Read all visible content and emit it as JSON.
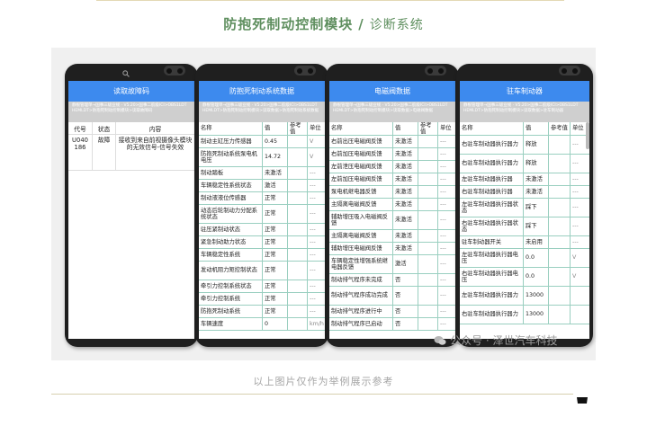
{
  "title": {
    "main": "防抱死制动控制模块",
    "separator": "/",
    "sub": "诊断系统"
  },
  "caption": "以上图片仅作为举例展示参考",
  "watermark": "公众号 · 泽世汽车科技",
  "phones": {
    "dtc": {
      "title": "读取故障码",
      "breadcrumb": "静根管理单→国事三级业规 · V5.20>国事二航级ICI>OBS1LDT HEMLDT>防抱死制动控制模块>读取故障码",
      "headers": {
        "code": "代号",
        "status": "状态",
        "content": "内容"
      },
      "row": {
        "code": "U040186",
        "status": "故障",
        "content": "接收到来自前视摄像头模块的无效信号-信号失效"
      }
    },
    "abs": {
      "title": "防抱死制动系统数据",
      "breadcrumb": "静根管理单→国事三级业规 · V5.20>国事二航级ICI>OBS1LDT HEMLDT>防抱死制动控制模块>读取数据>防抱死制动系统数据",
      "headers": {
        "name": "名称",
        "value": "值",
        "ref": "参考值",
        "unit": "单位"
      },
      "rows": [
        {
          "name": "制动主缸压力传感器",
          "value": "0.45",
          "ref": "",
          "unit": "V"
        },
        {
          "name": "防抱死制动系统泵电机电压",
          "value": "14.72",
          "ref": "",
          "unit": "V"
        },
        {
          "name": "制动踏板",
          "value": "未激活",
          "ref": "",
          "unit": "---"
        },
        {
          "name": "车辆稳定性系统状态",
          "value": "激活",
          "ref": "",
          "unit": "---"
        },
        {
          "name": "制动液液位传感器",
          "value": "正常",
          "ref": "",
          "unit": "---"
        },
        {
          "name": "动态后轮制动力分配系统状态",
          "value": "正常",
          "ref": "",
          "unit": "---"
        },
        {
          "name": "驻压紧制动状态",
          "value": "正常",
          "ref": "",
          "unit": "---"
        },
        {
          "name": "紧急制动助力状态",
          "value": "正常",
          "ref": "",
          "unit": "---"
        },
        {
          "name": "车辆稳定性系统",
          "value": "正常",
          "ref": "",
          "unit": "---"
        },
        {
          "name": "发动机阻力矩控制状态",
          "value": "正常",
          "ref": "",
          "unit": "---"
        },
        {
          "name": "牵引力控制系统状态",
          "value": "正常",
          "ref": "",
          "unit": "---"
        },
        {
          "name": "牵引力控制系统",
          "value": "正常",
          "ref": "",
          "unit": "---"
        },
        {
          "name": "防抱死制动系统",
          "value": "正常",
          "ref": "",
          "unit": "---"
        },
        {
          "name": "车辆速度",
          "value": "0",
          "ref": "",
          "unit": "km/h"
        }
      ]
    },
    "valve": {
      "title": "电磁阀数据",
      "breadcrumb": "静根管理单→国事三级业规 · V5.20>国事二航级ICI>OBS1LDT HEMLDT>防抱死制动控制模块>读取数据>电磁阀数据",
      "headers": {
        "name": "名称",
        "value": "值",
        "ref": "参考值",
        "unit": "单位"
      },
      "rows": [
        {
          "name": "右前出压电磁阀反馈",
          "value": "未激活",
          "ref": "",
          "unit": "---"
        },
        {
          "name": "右前加压电磁阀反馈",
          "value": "未激活",
          "ref": "",
          "unit": "---"
        },
        {
          "name": "左前泄压电磁阀反馈",
          "value": "未激活",
          "ref": "",
          "unit": "---"
        },
        {
          "name": "左前加压电磁阀反馈",
          "value": "未激活",
          "ref": "",
          "unit": "---"
        },
        {
          "name": "泵电机继电器反馈",
          "value": "未激活",
          "ref": "",
          "unit": "---"
        },
        {
          "name": "主隔离电磁阀反馈",
          "value": "未激活",
          "ref": "",
          "unit": "---"
        },
        {
          "name": "辅助增压吸入电磁阀反馈",
          "value": "未激活",
          "ref": "",
          "unit": "---"
        },
        {
          "name": "主隔离电磁阀反馈",
          "value": "未激活",
          "ref": "",
          "unit": "---"
        },
        {
          "name": "辅助增压电磁阀反馈",
          "value": "未激活",
          "ref": "",
          "unit": "---"
        },
        {
          "name": "车辆稳定性增强系统继电器反馈",
          "value": "激活",
          "ref": "",
          "unit": "---"
        },
        {
          "name": "制动排气程序未完成",
          "value": "否",
          "ref": "",
          "unit": "---"
        },
        {
          "name": "制动排气程序成功完成",
          "value": "否",
          "ref": "",
          "unit": "---"
        },
        {
          "name": "制动排气程序进行中",
          "value": "否",
          "ref": "",
          "unit": "---"
        },
        {
          "name": "制动排气程序已启动",
          "value": "否",
          "ref": "",
          "unit": "---"
        }
      ]
    },
    "park": {
      "title": "驻车制动器",
      "breadcrumb": "静根管理单→国事三级业规 · V5.20>国事二航级ICI>OBS1LDT HEMLDT>防抱死制动控制模块>读取数据>驻车制动器",
      "headers": {
        "name": "名称",
        "value": "值",
        "ref": "参考值",
        "unit": "单位"
      },
      "rows": [
        {
          "name": "右驻车制动器执行器力",
          "value": "释放",
          "ref": "",
          "unit": "---"
        },
        {
          "name": "右驻车制动器执行器力",
          "value": "释放",
          "ref": "",
          "unit": "---"
        },
        {
          "name": "左驻车制动器执行器",
          "value": "未激活",
          "ref": "",
          "unit": "---"
        },
        {
          "name": "右驻车制动器执行器",
          "value": "未激活",
          "ref": "",
          "unit": "---"
        },
        {
          "name": "左驻车制动器执行器状态",
          "value": "踩下",
          "ref": "",
          "unit": "---"
        },
        {
          "name": "右驻车制动器执行器状态",
          "value": "踩下",
          "ref": "",
          "unit": "---"
        },
        {
          "name": "驻车制动器开关",
          "value": "未启用",
          "ref": "",
          "unit": "---"
        },
        {
          "name": "左驻车制动器执行器电压",
          "value": "0.0",
          "ref": "",
          "unit": "V"
        },
        {
          "name": "右驻车制动器执行器电压",
          "value": "0.0",
          "ref": "",
          "unit": "V"
        },
        {
          "name": "左驻车制动器执行器力",
          "value": "13000",
          "ref": "",
          "unit": ""
        },
        {
          "name": "右驻车制动器执行器力",
          "value": "13000",
          "ref": "",
          "unit": ""
        }
      ]
    }
  }
}
